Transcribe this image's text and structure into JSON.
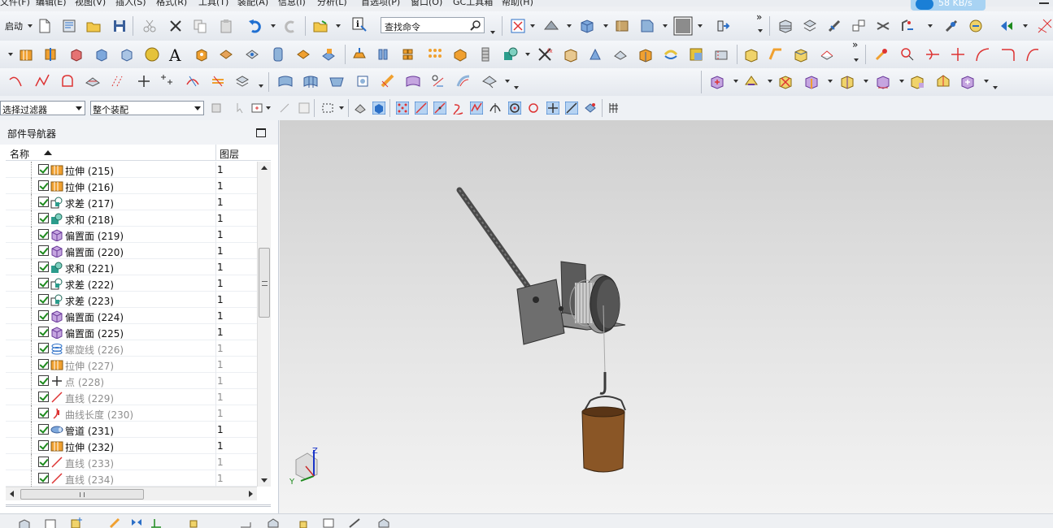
{
  "menubar": {
    "items": [
      "文件(F)",
      "编辑(E)",
      "视图(V)",
      "插入(S)",
      "格式(R)",
      "工具(T)",
      "装配(A)",
      "信息(I)",
      "分析(L)",
      "首选项(P)",
      "窗口(O)",
      "GC工具箱",
      "帮助(H)"
    ]
  },
  "network_badge": {
    "speed": "58 KB/s"
  },
  "toolbar": {
    "start_label": "启动",
    "command_search_placeholder": "查找命令"
  },
  "filter_bar": {
    "selection_filter": "选择过滤器",
    "assembly_scope": "整个装配"
  },
  "navigator": {
    "title": "部件导航器",
    "columns": {
      "name": "名称",
      "layer": "图层"
    },
    "rows": [
      {
        "label": "拉伸 (215)",
        "layer": "1",
        "icon": "extrude-icon",
        "dim": false
      },
      {
        "label": "拉伸 (216)",
        "layer": "1",
        "icon": "extrude-icon",
        "dim": false
      },
      {
        "label": "求差 (217)",
        "layer": "1",
        "icon": "subtract-icon",
        "dim": false
      },
      {
        "label": "求和 (218)",
        "layer": "1",
        "icon": "unite-icon",
        "dim": false
      },
      {
        "label": "偏置面 (219)",
        "layer": "1",
        "icon": "offset-face-icon",
        "dim": false
      },
      {
        "label": "偏置面 (220)",
        "layer": "1",
        "icon": "offset-face-icon",
        "dim": false
      },
      {
        "label": "求和 (221)",
        "layer": "1",
        "icon": "unite-icon",
        "dim": false
      },
      {
        "label": "求差 (222)",
        "layer": "1",
        "icon": "subtract-icon",
        "dim": false
      },
      {
        "label": "求差 (223)",
        "layer": "1",
        "icon": "subtract-icon",
        "dim": false
      },
      {
        "label": "偏置面 (224)",
        "layer": "1",
        "icon": "offset-face-icon",
        "dim": false
      },
      {
        "label": "偏置面 (225)",
        "layer": "1",
        "icon": "offset-face-icon",
        "dim": false
      },
      {
        "label": "螺旋线 (226)",
        "layer": "1",
        "icon": "helix-icon",
        "dim": true
      },
      {
        "label": "拉伸 (227)",
        "layer": "1",
        "icon": "extrude-icon",
        "dim": true
      },
      {
        "label": "点 (228)",
        "layer": "1",
        "icon": "point-icon",
        "dim": true
      },
      {
        "label": "直线 (229)",
        "layer": "1",
        "icon": "line-icon",
        "dim": true
      },
      {
        "label": "曲线长度 (230)",
        "layer": "1",
        "icon": "curve-length-icon",
        "dim": true
      },
      {
        "label": "管道 (231)",
        "layer": "1",
        "icon": "tube-icon",
        "dim": false
      },
      {
        "label": "拉伸 (232)",
        "layer": "1",
        "icon": "extrude-icon",
        "dim": false
      },
      {
        "label": "直线 (233)",
        "layer": "1",
        "icon": "line-icon",
        "dim": true
      },
      {
        "label": "直线 (234)",
        "layer": "1",
        "icon": "line-icon",
        "dim": true
      }
    ]
  },
  "triad": {
    "z": "Z",
    "y": "Y"
  },
  "colors": {
    "model_gray": "#6e6e6e",
    "bucket_brown": "#8a5626",
    "check_green": "#1d8a1d",
    "accent_blue": "#2b6fc7"
  }
}
